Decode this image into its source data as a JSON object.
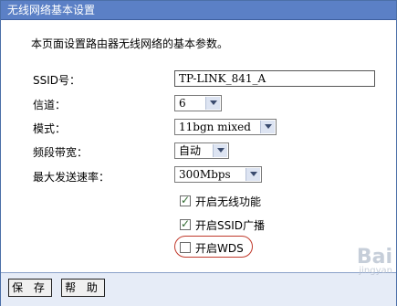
{
  "window": {
    "title": "无线网络基本设置"
  },
  "description": "本页面设置路由器无线网络的基本参数。",
  "fields": {
    "ssid": {
      "label": "SSID号：",
      "value": "TP-LINK_841_A"
    },
    "channel": {
      "label": "信道：",
      "value": "6"
    },
    "mode": {
      "label": "模式：",
      "value": "11bgn mixed"
    },
    "bandwidth": {
      "label": "频段带宽：",
      "value": "自动"
    },
    "max_rate": {
      "label": "最大发送速率：",
      "value": "300Mbps"
    }
  },
  "checkboxes": {
    "wireless": {
      "label": "开启无线功能",
      "checked": true
    },
    "ssid_broadcast": {
      "label": "开启SSID广播",
      "checked": true
    },
    "wds": {
      "label": "开启WDS",
      "checked": false
    }
  },
  "buttons": {
    "save": "保 存",
    "help": "帮 助"
  },
  "watermark": {
    "logo": "Bai",
    "sub": "jingyan"
  },
  "colors": {
    "title_bar": "#5b80c6",
    "footer": "#e6ecf7",
    "highlight": "#c0392b"
  }
}
